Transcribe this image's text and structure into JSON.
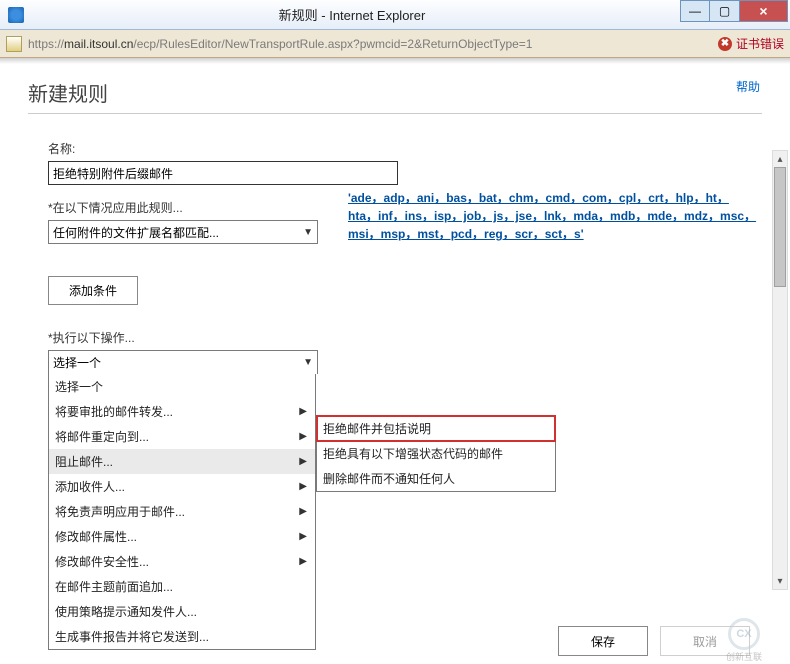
{
  "window": {
    "title": "新规则 - Internet Explorer",
    "min": "—",
    "max": "▢",
    "close": "×"
  },
  "addressbar": {
    "url_prefix": "https://",
    "url_host": "mail.itsoul.cn",
    "url_path": "/ecp/RulesEditor/NewTransportRule.aspx?pwmcid=2&ReturnObjectType=1",
    "cert_error": "证书错误"
  },
  "page": {
    "help": "帮助",
    "title": "新建规则"
  },
  "form": {
    "name_label": "名称:",
    "name_value": "拒绝特别附件后缀邮件",
    "apply_when_label": "*在以下情况应用此规则...",
    "apply_when_value": "任何附件的文件扩展名都匹配...",
    "extension_text": "'ade，adp，ani，bas，bat，chm，cmd，com，cpl，crt，hlp，ht，hta，inf，ins，isp，job，js，jse，lnk，mda，mdb，mde，mdz，msc，msi，msp，mst，pcd，reg，scr，sct，s'",
    "add_condition_btn": "添加条件",
    "do_action_label": "*执行以下操作...",
    "do_action_value": "选择一个"
  },
  "dropdown": {
    "items": [
      {
        "label": "选择一个",
        "has_sub": false
      },
      {
        "label": "将要审批的邮件转发...",
        "has_sub": true
      },
      {
        "label": "将邮件重定向到...",
        "has_sub": true
      },
      {
        "label": "阻止邮件...",
        "has_sub": true,
        "hover": true
      },
      {
        "label": "添加收件人...",
        "has_sub": true
      },
      {
        "label": "将免责声明应用于邮件...",
        "has_sub": true
      },
      {
        "label": "修改邮件属性...",
        "has_sub": true
      },
      {
        "label": "修改邮件安全性...",
        "has_sub": true
      },
      {
        "label": "在邮件主题前面追加...",
        "has_sub": false
      },
      {
        "label": "使用策略提示通知发件人...",
        "has_sub": false
      },
      {
        "label": "生成事件报告并将它发送到...",
        "has_sub": false
      }
    ]
  },
  "submenu": {
    "items": [
      {
        "label": "拒绝邮件并包括说明",
        "highlight": true
      },
      {
        "label": "拒绝具有以下增强状态代码的邮件",
        "highlight": false
      },
      {
        "label": "删除邮件而不通知任何人",
        "highlight": false
      }
    ]
  },
  "footer": {
    "save": "保存",
    "cancel": "取消"
  },
  "watermark": "创新互联"
}
